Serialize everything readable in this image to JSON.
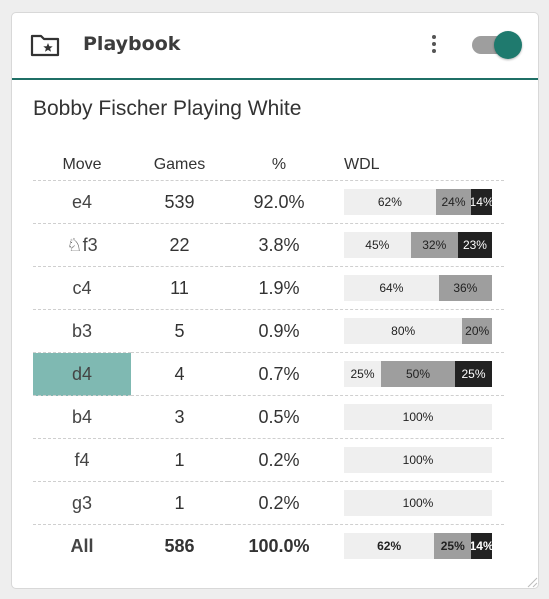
{
  "header": {
    "title": "Playbook",
    "toggle_on": true,
    "accent_color": "#1f7a6e"
  },
  "subtitle": "Bobby Fischer Playing White",
  "columns": [
    "Move",
    "Games",
    "%",
    "WDL"
  ],
  "rows": [
    {
      "move": "e4",
      "piece": "",
      "games": "539",
      "pct": "92.0%",
      "selected": false,
      "wdl": {
        "w": 62,
        "d": 24,
        "l": 14
      },
      "wdl_labels": {
        "w": "62%",
        "d": "24%",
        "l": "14%"
      }
    },
    {
      "move": "f3",
      "piece": "♘",
      "games": "22",
      "pct": "3.8%",
      "selected": false,
      "wdl": {
        "w": 45,
        "d": 32,
        "l": 23
      },
      "wdl_labels": {
        "w": "45%",
        "d": "32%",
        "l": "23%"
      }
    },
    {
      "move": "c4",
      "piece": "",
      "games": "11",
      "pct": "1.9%",
      "selected": false,
      "wdl": {
        "w": 64,
        "d": 36,
        "l": 0
      },
      "wdl_labels": {
        "w": "64%",
        "d": "36%",
        "l": ""
      }
    },
    {
      "move": "b3",
      "piece": "",
      "games": "5",
      "pct": "0.9%",
      "selected": false,
      "wdl": {
        "w": 80,
        "d": 20,
        "l": 0
      },
      "wdl_labels": {
        "w": "80%",
        "d": "20%",
        "l": ""
      }
    },
    {
      "move": "d4",
      "piece": "",
      "games": "4",
      "pct": "0.7%",
      "selected": true,
      "wdl": {
        "w": 25,
        "d": 50,
        "l": 25
      },
      "wdl_labels": {
        "w": "25%",
        "d": "50%",
        "l": "25%"
      }
    },
    {
      "move": "b4",
      "piece": "",
      "games": "3",
      "pct": "0.5%",
      "selected": false,
      "wdl": {
        "w": 100,
        "d": 0,
        "l": 0
      },
      "wdl_labels": {
        "w": "100%",
        "d": "",
        "l": ""
      }
    },
    {
      "move": "f4",
      "piece": "",
      "games": "1",
      "pct": "0.2%",
      "selected": false,
      "wdl": {
        "w": 100,
        "d": 0,
        "l": 0
      },
      "wdl_labels": {
        "w": "100%",
        "d": "",
        "l": ""
      }
    },
    {
      "move": "g3",
      "piece": "",
      "games": "1",
      "pct": "0.2%",
      "selected": false,
      "wdl": {
        "w": 100,
        "d": 0,
        "l": 0
      },
      "wdl_labels": {
        "w": "100%",
        "d": "",
        "l": ""
      }
    }
  ],
  "total": {
    "move": "All",
    "games": "586",
    "pct": "100.0%",
    "wdl": {
      "w": 61,
      "d": 25,
      "l": 14
    },
    "wdl_labels": {
      "w": "62%",
      "d": "25%",
      "l": "14%"
    }
  },
  "colors": {
    "win": "#efefef",
    "draw": "#9e9e9e",
    "loss": "#222222",
    "selected_row": "#7fb9b2"
  }
}
